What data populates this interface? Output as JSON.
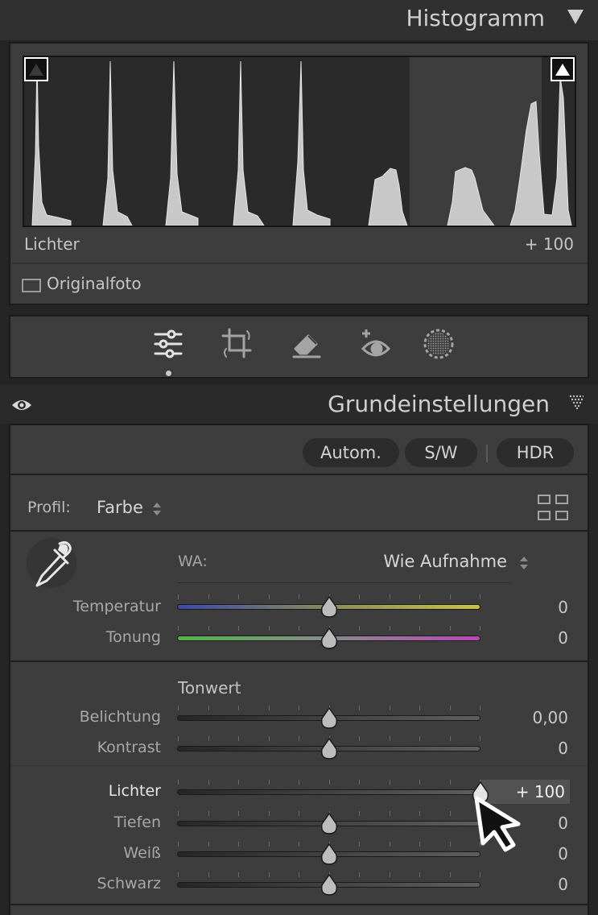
{
  "histogram": {
    "title": "Histogramm",
    "info_label": "Lichter",
    "info_value": "+ 100",
    "original_label": "Originalfoto",
    "highlighted_region": [
      0.7,
      0.94
    ]
  },
  "tools": [
    {
      "name": "edit-sliders-icon",
      "active": true
    },
    {
      "name": "crop-icon",
      "active": false
    },
    {
      "name": "heal-eraser-icon",
      "active": false
    },
    {
      "name": "red-eye-icon",
      "active": false
    },
    {
      "name": "masking-icon",
      "active": false
    }
  ],
  "basic": {
    "title": "Grundeinstellungen",
    "buttons": {
      "auto": "Autom.",
      "bw": "S/W",
      "hdr": "HDR"
    },
    "profile_label": "Profil:",
    "profile_value": "Farbe",
    "wb_label": "WA:",
    "wb_value": "Wie Aufnahme",
    "tone_heading": "Tonwert",
    "sliders": {
      "temperature": {
        "label": "Temperatur",
        "value": "0",
        "position": 0.5
      },
      "tint": {
        "label": "Tonung",
        "value": "0",
        "position": 0.5
      },
      "exposure": {
        "label": "Belichtung",
        "value": "0,00",
        "position": 0.5
      },
      "contrast": {
        "label": "Kontrast",
        "value": "0",
        "position": 0.5
      },
      "highlights": {
        "label": "Lichter",
        "value": "+ 100",
        "position": 1.0
      },
      "shadows": {
        "label": "Tiefen",
        "value": "0",
        "position": 0.5
      },
      "whites": {
        "label": "Weiß",
        "value": "0",
        "position": 0.5
      },
      "blacks": {
        "label": "Schwarz",
        "value": "0",
        "position": 0.5
      }
    }
  },
  "colors": {
    "panel_bg": "#3d3d3d",
    "header_bg": "#303030",
    "active_value_bg": "#525252"
  }
}
